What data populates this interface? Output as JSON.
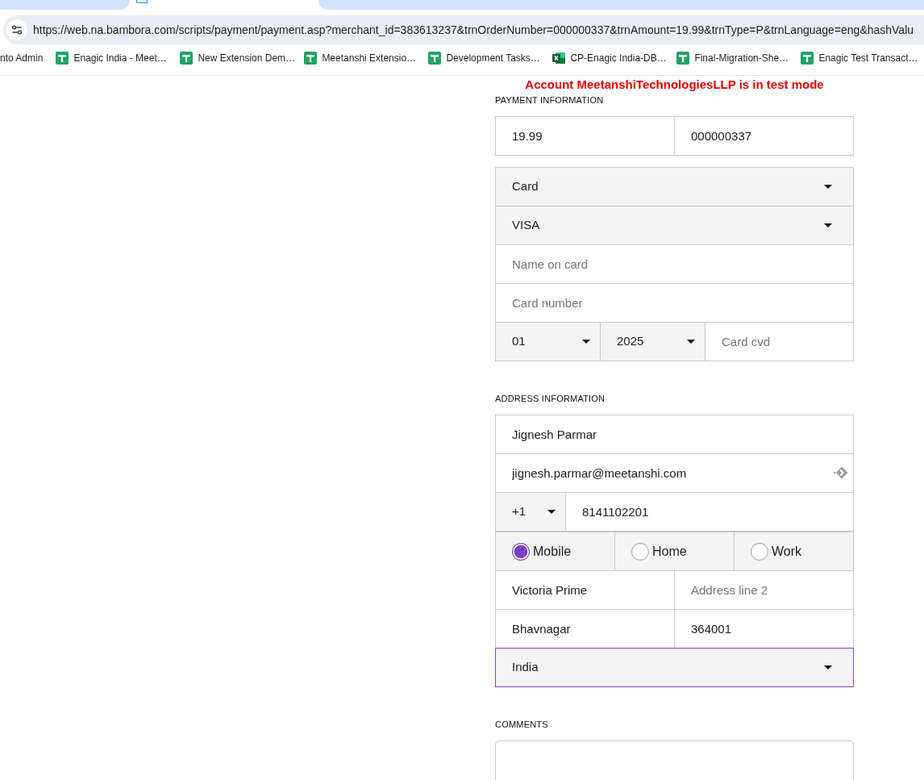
{
  "browser": {
    "tabs": [
      {
        "selected": false
      },
      {
        "selected": true
      },
      {
        "selected": false
      }
    ],
    "url": "https://web.na.bambora.com/scripts/payment/payment.asp?merchant_id=383613237&trnOrderNumber=000000337&trnAmount=19.99&trnType=P&trnLanguage=eng&hashValu",
    "bookmarks": [
      {
        "label": "nto Admin",
        "kind": "text"
      },
      {
        "label": "Enagic India - Meet…",
        "kind": "sheet"
      },
      {
        "label": "New Extension Dem…",
        "kind": "sheet"
      },
      {
        "label": "Meetanshi Extensio…",
        "kind": "sheet"
      },
      {
        "label": "Development Tasks…",
        "kind": "sheet"
      },
      {
        "label": "CP-Enagic India-DB…",
        "kind": "workbook"
      },
      {
        "label": "Final-Migration-She…",
        "kind": "sheet"
      },
      {
        "label": "Enagic Test Transact…",
        "kind": "sheet"
      }
    ]
  },
  "notice": "Account MeetanshiTechnologiesLLP is in test mode",
  "sections": [
    {
      "heading": "PAYMENT INFORMATION",
      "groups": [
        {
          "rows": [
            [
              {
                "kind": "input",
                "value": "19.99",
                "focused": false
              },
              {
                "kind": "input",
                "value": "000000337",
                "focused": false
              }
            ]
          ]
        },
        {
          "rows": [
            [
              {
                "kind": "select",
                "value": "Card",
                "focused": false
              }
            ],
            [
              {
                "kind": "select",
                "value": "VISA",
                "focused": false
              }
            ],
            [
              {
                "kind": "input",
                "placeholder": "Name on card",
                "focused": false
              }
            ],
            [
              {
                "kind": "input",
                "placeholder": "Card number",
                "focused": false
              }
            ],
            [
              {
                "kind": "select",
                "value": "01",
                "focused": false
              },
              {
                "kind": "select",
                "value": "2025",
                "focused": false
              },
              {
                "kind": "input",
                "placeholder": "Card cvd",
                "focused": false
              }
            ]
          ]
        }
      ]
    },
    {
      "heading": "ADDRESS INFORMATION",
      "groups": [
        {
          "rows": [
            [
              {
                "kind": "input",
                "value": "Jignesh Parmar",
                "focused": false
              }
            ],
            [
              {
                "kind": "input",
                "value": "jignesh.parmar@meetanshi.com",
                "focused": false,
                "autofill": true
              }
            ],
            [
              {
                "kind": "select",
                "value": "+1",
                "focused": false
              },
              {
                "kind": "input",
                "value": "8141102201",
                "focused": false
              }
            ],
            [
              {
                "kind": "radio",
                "label": "Mobile",
                "selected": true
              },
              {
                "kind": "radio",
                "label": "Home",
                "selected": false
              },
              {
                "kind": "radio",
                "label": "Work",
                "selected": false
              }
            ],
            [
              {
                "kind": "input",
                "value": "Victoria Prime",
                "focused": false
              },
              {
                "kind": "input",
                "placeholder": "Address line 2",
                "focused": false
              }
            ],
            [
              {
                "kind": "input",
                "value": "Bhavnagar",
                "focused": false
              },
              {
                "kind": "input",
                "value": "364001",
                "focused": false
              }
            ],
            [
              {
                "kind": "select",
                "value": "India",
                "focused": true
              }
            ]
          ]
        }
      ]
    },
    {
      "heading": "COMMENTS",
      "groups": [
        {
          "rows": [
            [
              {
                "kind": "textarea"
              }
            ]
          ]
        }
      ]
    }
  ]
}
